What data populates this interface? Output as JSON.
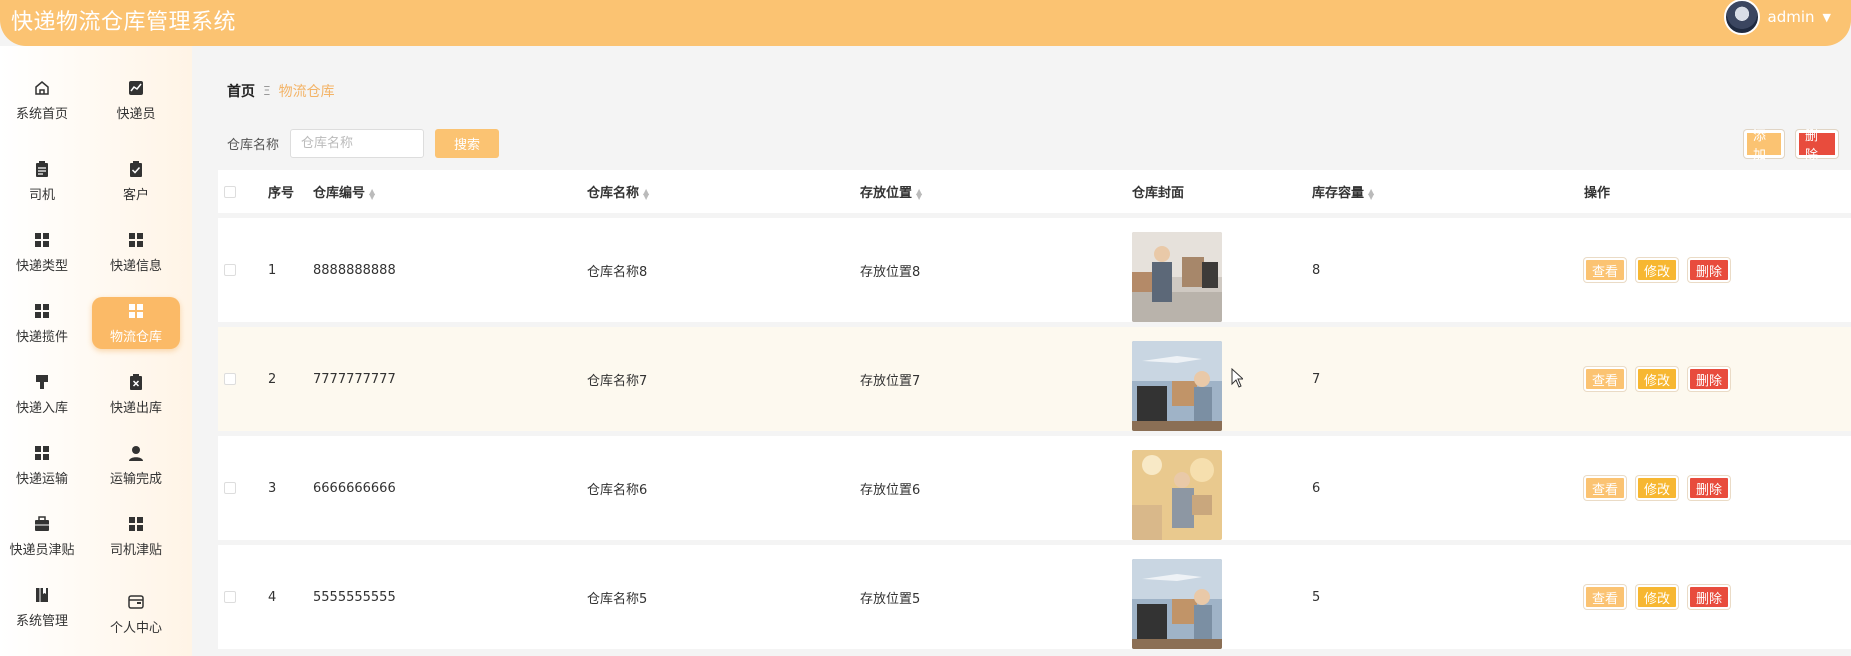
{
  "app": {
    "title": "快递物流仓库管理系统",
    "user": "admin"
  },
  "sidebar": {
    "items": [
      {
        "label": "系统首页",
        "icon": "home-icon",
        "active": false
      },
      {
        "label": "快递员",
        "icon": "chart-icon",
        "active": false
      },
      {
        "label": "司机",
        "icon": "clipboard-icon",
        "active": false
      },
      {
        "label": "客户",
        "icon": "clipboard-check-icon",
        "active": false
      },
      {
        "label": "快递类型",
        "icon": "grid-icon",
        "active": false
      },
      {
        "label": "快递信息",
        "icon": "grid-icon",
        "active": false
      },
      {
        "label": "快递揽件",
        "icon": "grid-icon",
        "active": false
      },
      {
        "label": "物流仓库",
        "icon": "grid-icon",
        "active": true
      },
      {
        "label": "快递入库",
        "icon": "brush-icon",
        "active": false
      },
      {
        "label": "快递出库",
        "icon": "clipboard-x-icon",
        "active": false
      },
      {
        "label": "快递运输",
        "icon": "grid-icon",
        "active": false
      },
      {
        "label": "运输完成",
        "icon": "user-icon",
        "active": false
      },
      {
        "label": "快递员津贴",
        "icon": "briefcase-icon",
        "active": false
      },
      {
        "label": "司机津贴",
        "icon": "grid-icon",
        "active": false
      },
      {
        "label": "系统管理",
        "icon": "book-icon",
        "active": false
      },
      {
        "label": "个人中心",
        "icon": "wallet-icon",
        "active": false
      }
    ]
  },
  "breadcrumb": {
    "home": "首页",
    "separator": "Ξ",
    "current": "物流仓库"
  },
  "search": {
    "label": "仓库名称",
    "placeholder": "仓库名称",
    "value": "",
    "button": "搜索"
  },
  "toolbar": {
    "add": "添加",
    "delete": "删除"
  },
  "table": {
    "headers": {
      "index": "序号",
      "code": "仓库编号",
      "name": "仓库名称",
      "location": "存放位置",
      "cover": "仓库封面",
      "capacity": "库存容量",
      "actions": "操作"
    },
    "rows": [
      {
        "index": "1",
        "code": "8888888888",
        "name": "仓库名称8",
        "location": "存放位置8",
        "capacity": "8"
      },
      {
        "index": "2",
        "code": "7777777777",
        "name": "仓库名称7",
        "location": "存放位置7",
        "capacity": "7"
      },
      {
        "index": "3",
        "code": "6666666666",
        "name": "仓库名称6",
        "location": "存放位置6",
        "capacity": "6"
      },
      {
        "index": "4",
        "code": "5555555555",
        "name": "仓库名称5",
        "location": "存放位置5",
        "capacity": "5"
      }
    ],
    "actions": {
      "view": "查看",
      "edit": "修改",
      "delete": "删除"
    }
  },
  "colors": {
    "accent": "#fbc372",
    "danger": "#e84c3d",
    "warning": "#f7b731"
  }
}
